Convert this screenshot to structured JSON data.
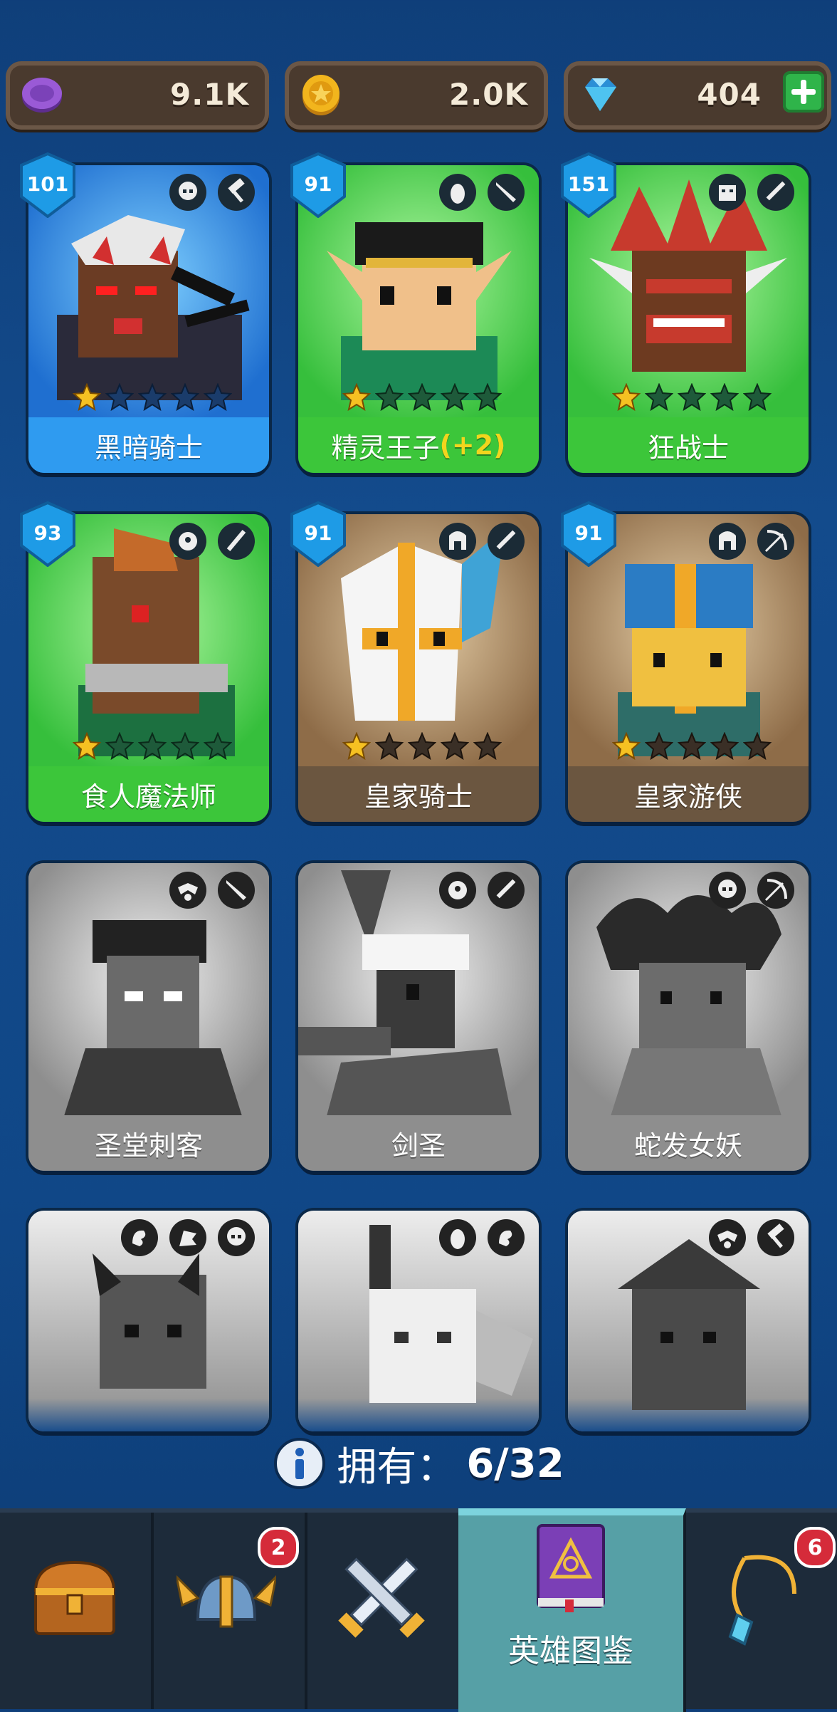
{
  "resources": [
    {
      "name": "purple-token",
      "value": "9.1K",
      "color": "#8a4fc4"
    },
    {
      "name": "gold-coin",
      "value": "2.0K",
      "color": "#f2b51d"
    },
    {
      "name": "diamond",
      "value": "404",
      "color": "#4ec3f0"
    }
  ],
  "heroes": [
    {
      "name": "黑暗骑士",
      "level": "101",
      "stars": 1,
      "owned": true,
      "bg": "blue"
    },
    {
      "name": "精灵王子",
      "bonus": "(+2)",
      "level": "91",
      "stars": 1,
      "owned": true,
      "bg": "green"
    },
    {
      "name": "狂战士",
      "level": "151",
      "stars": 1,
      "owned": true,
      "bg": "green"
    },
    {
      "name": "食人魔法师",
      "level": "93",
      "stars": 1,
      "owned": true,
      "bg": "green"
    },
    {
      "name": "皇家骑士",
      "level": "91",
      "stars": 1,
      "owned": true,
      "bg": "brown"
    },
    {
      "name": "皇家游侠",
      "level": "91",
      "stars": 1,
      "owned": true,
      "bg": "brown"
    },
    {
      "name": "圣堂刺客",
      "owned": false
    },
    {
      "name": "剑圣",
      "owned": false
    },
    {
      "name": "蛇发女妖",
      "owned": false
    },
    {
      "name": "",
      "owned": false
    },
    {
      "name": "",
      "owned": false
    },
    {
      "name": "",
      "owned": false
    }
  ],
  "owned": {
    "label": "拥有：",
    "value": "6/32"
  },
  "tabs": [
    {
      "name": "chest",
      "badge": ""
    },
    {
      "name": "helmet",
      "badge": "2"
    },
    {
      "name": "battle",
      "badge": ""
    },
    {
      "name": "hero-book",
      "label": "英雄图鉴",
      "badge": ""
    },
    {
      "name": "amulet",
      "badge": "6"
    }
  ]
}
